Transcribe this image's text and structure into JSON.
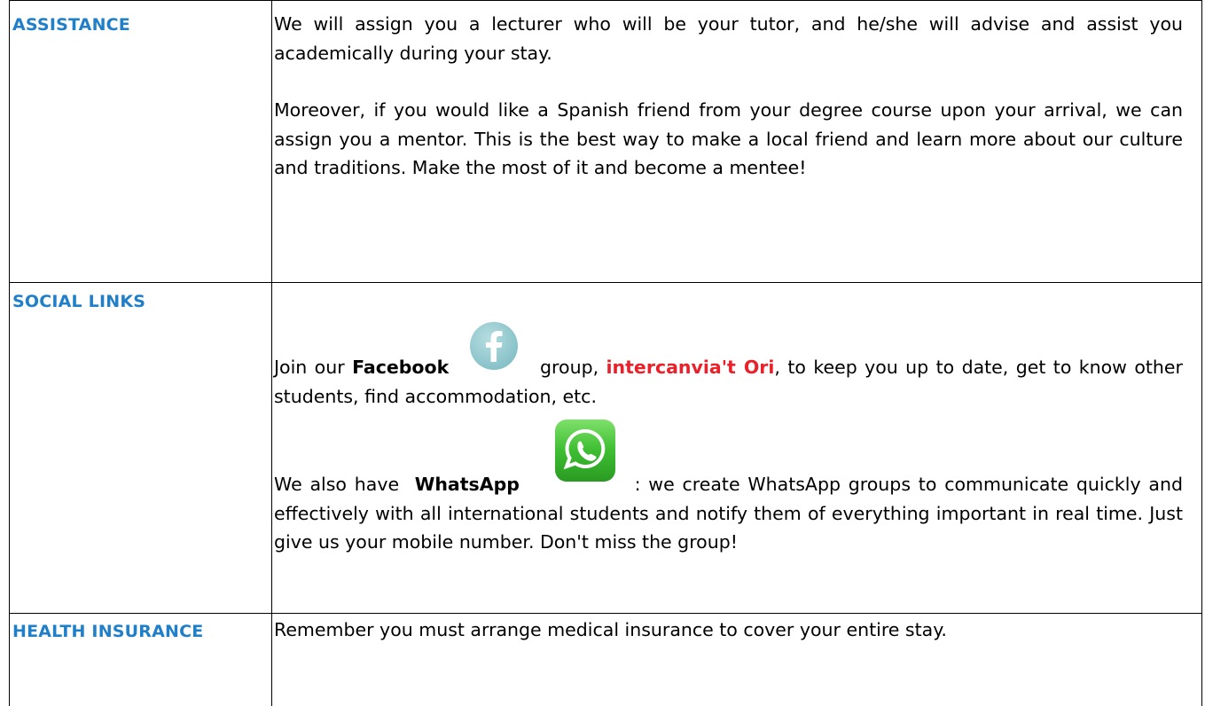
{
  "sections": {
    "assistance": {
      "heading": "ASSISTANCE",
      "para1": "We will assign you a lecturer who will be your tutor, and he/she will advise and assist you academically during your stay.",
      "para2": "Moreover, if you would like a Spanish friend from your degree course upon your arrival, we can assign you a mentor. This is the best way to make a local friend and learn more about our culture and traditions. Make the most of it and become a mentee!"
    },
    "social": {
      "heading": "SOCIAL LINKS",
      "fb_intro": "Join our",
      "fb_name": "Facebook",
      "fb_group_word": "group,",
      "fb_group_name": "intercanvia't Ori",
      "fb_rest": ", to keep you up to date, get to know other students, find accommodation, etc.",
      "wa_intro": "We also have",
      "wa_name": "WhatsApp",
      "wa_rest": ": we create WhatsApp groups to communicate quickly and effectively with all international students and notify them of everything important in real time. Just give us your mobile number. Don't miss the group!"
    },
    "health": {
      "heading": "HEALTH INSURANCE",
      "text": "Remember you must arrange medical insurance to cover your entire stay."
    }
  },
  "icons": {
    "facebook": "facebook-icon",
    "whatsapp": "whatsapp-icon"
  },
  "colors": {
    "heading": "#1f7fc8",
    "highlight": "#e8212a",
    "facebook_bg": "#9fcfd4",
    "whatsapp_bg": "#3fb33f"
  }
}
